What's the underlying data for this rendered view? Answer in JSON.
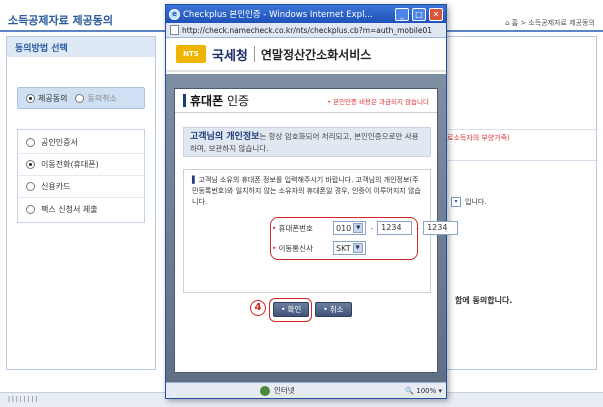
{
  "page": {
    "title": "소득공제자료 제공동의",
    "breadcrumb": "⌂ 홈 > 소득공제자료 제공동의",
    "left_header": "동의방법 선택",
    "toggle": [
      "제공동의",
      "동의취소"
    ],
    "methods": [
      "공인인증서",
      "이동전화(휴대폰)",
      "신용카드",
      "팩스 신청서 제출"
    ],
    "selected_method": 1,
    "right_red_note": "로소득자의 부양가족)",
    "right_select_suffix": "입니다.",
    "right_agree_text": "함에 동의합니다.",
    "footer_text": "| | | | | | | |"
  },
  "popup": {
    "window_title": "Checkplus 본인인증 - Windows Internet Expl...",
    "address": "http://check.namecheck.co.kr/nts/checkplus.cb?m=auth_mobile01",
    "logo_text": "NTS",
    "agency": "국세청",
    "service": "연말정산간소화서비스",
    "panel_title_bold": "휴대폰",
    "panel_title_rest": " 인증",
    "fee_note": "• 본인인증 비용은 과금되지 않습니다",
    "info_highlight": "고객님의 개인정보",
    "info_rest": "는 항상 암호화되어 처리되고, 본인인증으로만 사용하며, 보관하지 않습니다.",
    "description": "고객님 소유의 휴대폰 정보를 입력해주시기 바랍니다. 고객님의 개인정보(주민등록번호)와 일치하지 않는 소유자의 휴대폰일 경우, 인증이 이루어지지 않습니다.",
    "phone_label": "휴대폰번호",
    "phone_prefix": "010",
    "phone_mid": "1234",
    "phone_last": "1234",
    "carrier_label": "이동통신사",
    "carrier": "SKT",
    "step_number": "4",
    "confirm_label": "확인",
    "cancel_label": "취소",
    "status_zone": "인터넷",
    "zoom": "100%"
  },
  "colors": {
    "accent": "#2a5a9e",
    "highlight_ring": "#d42424"
  }
}
